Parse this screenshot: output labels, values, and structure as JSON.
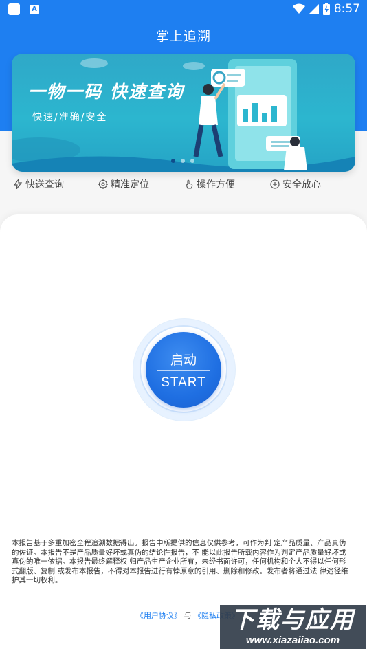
{
  "status_bar": {
    "notif_icon_a": "A",
    "time": "8:57"
  },
  "header": {
    "title": "掌上追溯"
  },
  "banner": {
    "title": "一物一码 快速查询",
    "subtitle": "快速/准确/安全",
    "slide_count": 3,
    "active_slide": 0
  },
  "features": [
    {
      "icon": "lightning-icon",
      "label": "快送查询"
    },
    {
      "icon": "target-icon",
      "label": "精准定位"
    },
    {
      "icon": "hand-pointer-icon",
      "label": "操作方便"
    },
    {
      "icon": "shield-plus-icon",
      "label": "安全放心"
    }
  ],
  "start_button": {
    "label_cn": "启动",
    "label_en": "START"
  },
  "disclaimer": "本报告基于多重加密全程追溯数据得出。报告中所提供的信息仅供参考，可作为判 定产品质量、产品真伪的佐证。本报告不是产品质量好坏或真伪的结论性报告，不 能以此报告所载内容作为判定产品质量好坏或真伪的唯一依据。本报告最终解释权 归产品生产企业所有，未经书面许可，任何机构和个人不得以任何形式翻版、复制 或发布本报告，不得对本报告进行有悖原意的引用、删除和修改。发布者将通过法 律途径维护其一切权利。",
  "footer": {
    "user_agreement": "《用户协议》",
    "and": "与",
    "privacy_policy": "《隐私政策》"
  },
  "watermark": {
    "main": "下载与应用",
    "url": "www.xiazaiiao.com"
  },
  "colors": {
    "brand_blue": "#1e7ff1",
    "banner_teal": "#2cb6cf",
    "start_blue": "#1f6fe2"
  }
}
